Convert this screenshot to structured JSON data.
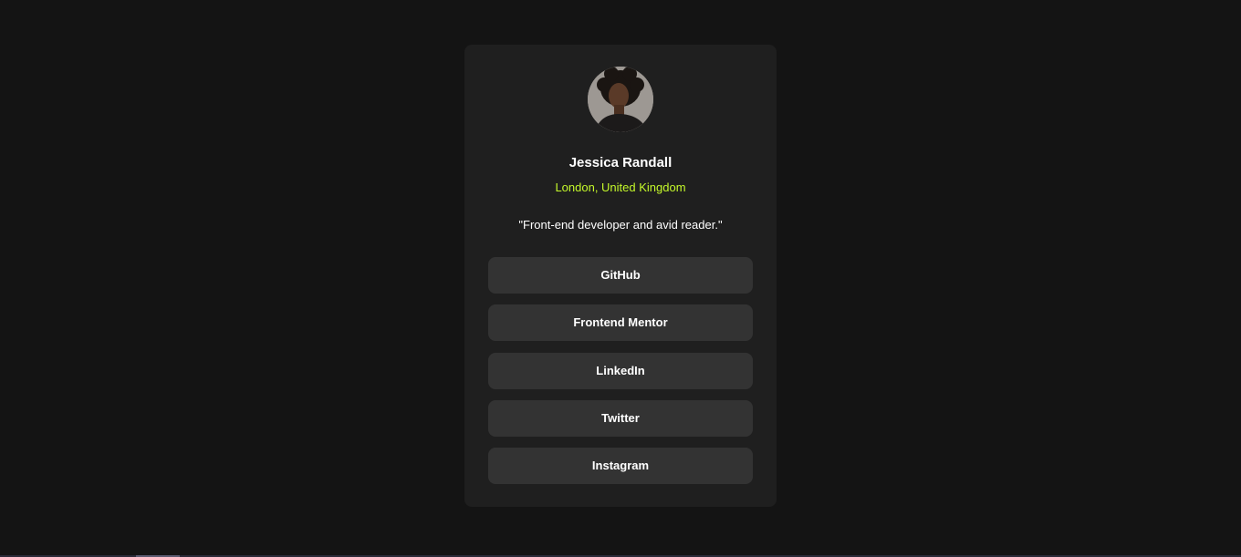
{
  "profile": {
    "name": "Jessica Randall",
    "location": "London, United Kingdom",
    "bio": "\"Front-end developer and avid reader.\""
  },
  "links": [
    {
      "label": "GitHub"
    },
    {
      "label": "Frontend Mentor"
    },
    {
      "label": "LinkedIn"
    },
    {
      "label": "Twitter"
    },
    {
      "label": "Instagram"
    }
  ],
  "colors": {
    "background": "#141414",
    "card": "#1f1f1f",
    "button": "#333333",
    "accent": "#c4f82a",
    "text": "#ffffff"
  }
}
